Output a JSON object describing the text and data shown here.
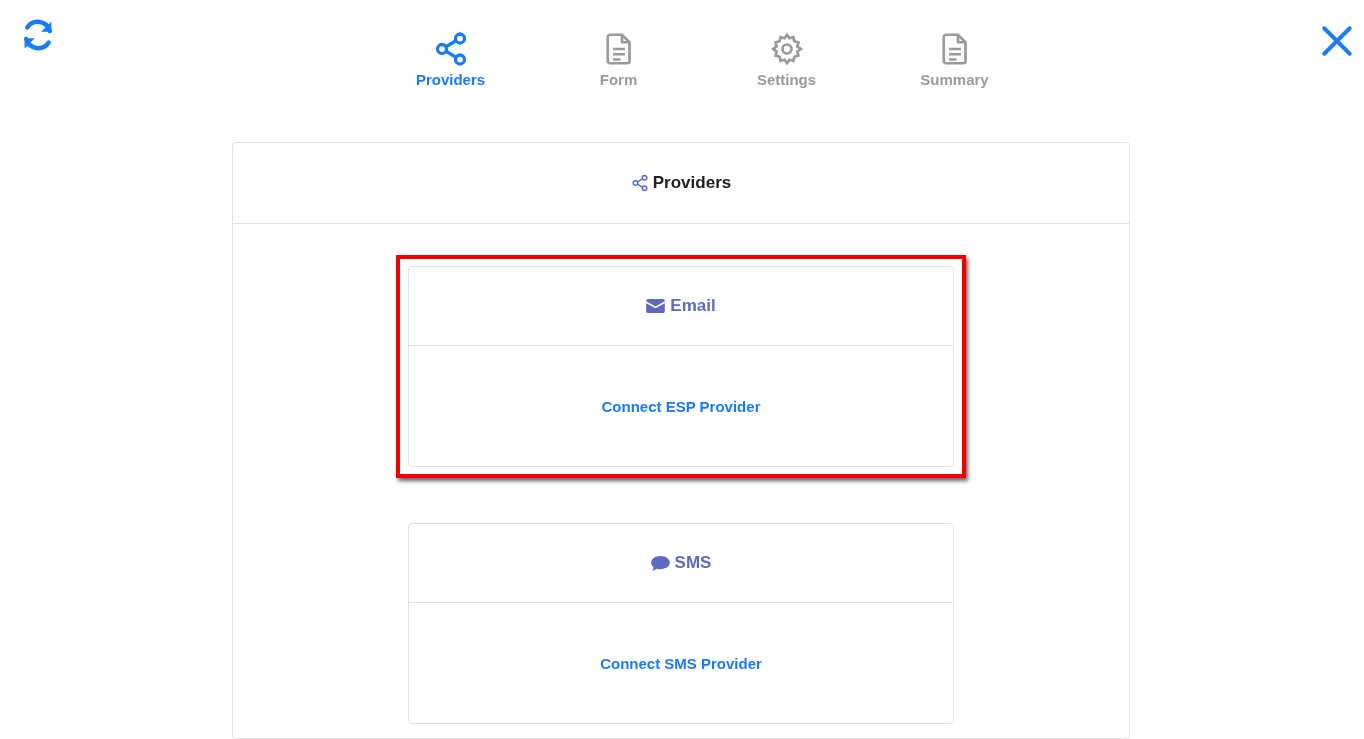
{
  "steps": [
    {
      "label": "Providers",
      "selected": true
    },
    {
      "label": "Form",
      "selected": false
    },
    {
      "label": "Settings",
      "selected": false
    },
    {
      "label": "Summary",
      "selected": false
    }
  ],
  "panel": {
    "title": "Providers"
  },
  "providers": [
    {
      "title": "Email",
      "action": "Connect ESP Provider",
      "highlighted": true
    },
    {
      "title": "SMS",
      "action": "Connect SMS Provider",
      "highlighted": false
    }
  ]
}
